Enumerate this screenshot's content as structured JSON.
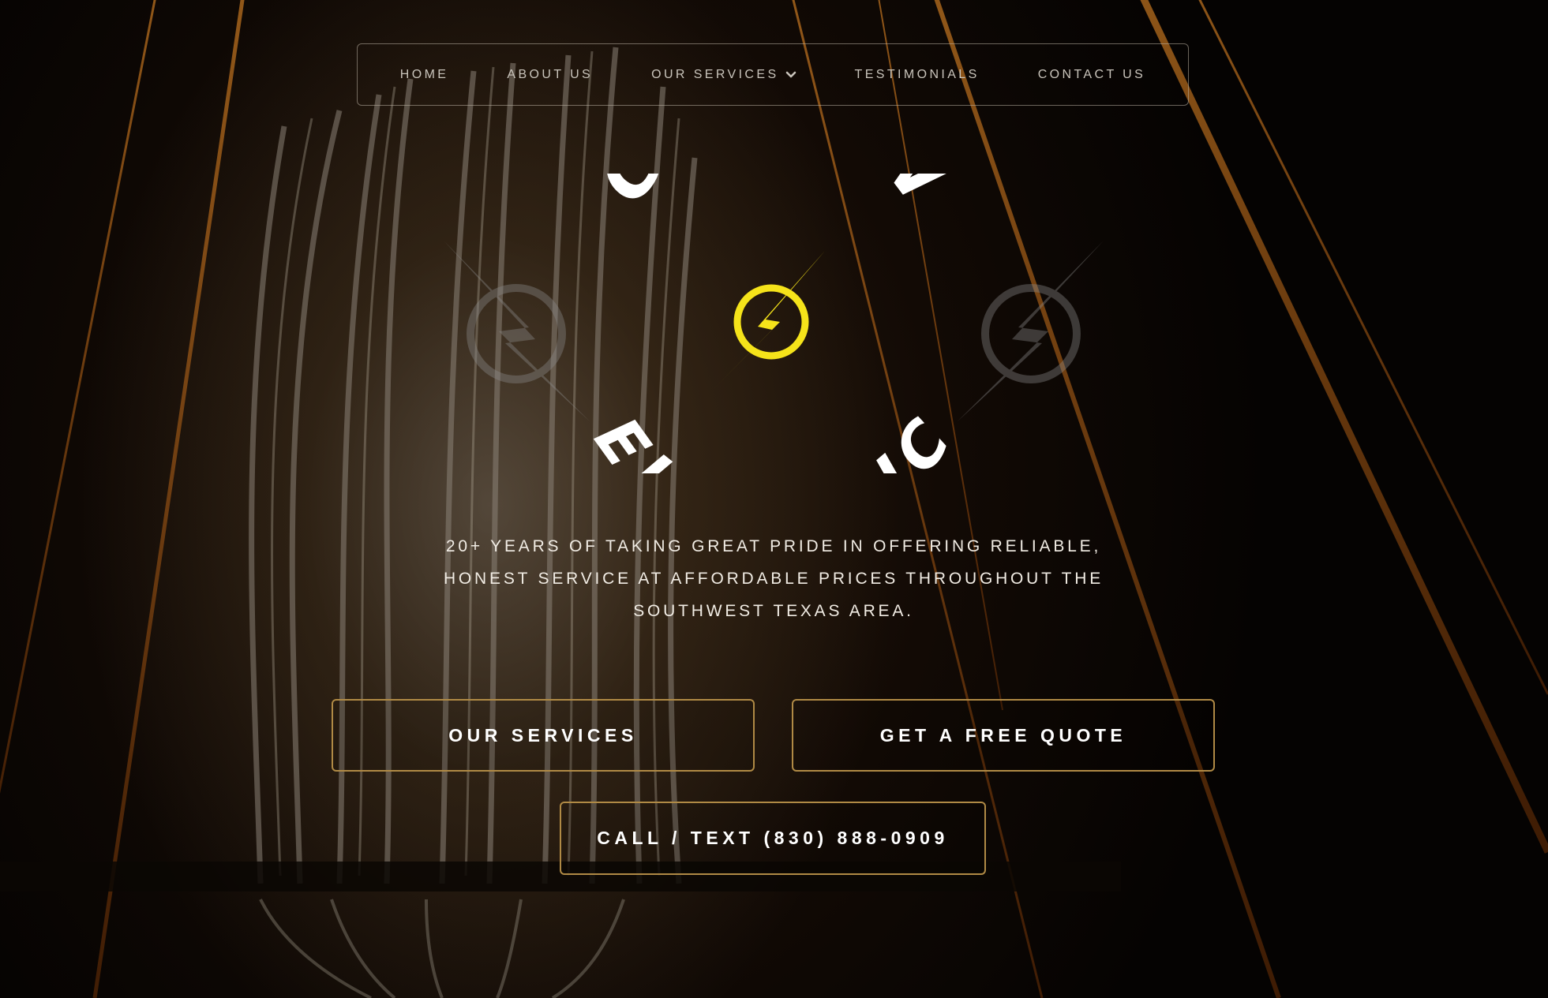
{
  "nav": {
    "items": [
      {
        "label": "HOME"
      },
      {
        "label": "ABOUT US"
      },
      {
        "label": "OUR SERVICES",
        "has_dropdown": true
      },
      {
        "label": "TESTIMONIALS"
      },
      {
        "label": "CONTACT US"
      }
    ]
  },
  "logo": {
    "top_word": "GALVAN",
    "bottom_word": "ELECTRIC",
    "icon": "lightning-bolt-icon",
    "accent_color": "#f5e31a"
  },
  "hero": {
    "tagline_lines": [
      "20+ YEARS OF TAKING GREAT PRIDE IN OFFERING RELIABLE,",
      "HONEST SERVICE AT AFFORDABLE PRICES THROUGHOUT THE",
      "SOUTHWEST TEXAS AREA."
    ]
  },
  "buttons": {
    "services": "OUR SERVICES",
    "quote": "GET A FREE QUOTE",
    "call": "CALL / TEXT (830) 888-0909"
  },
  "colors": {
    "button_border": "#b08a45",
    "nav_text": "#c9c4bb",
    "text": "#ffffff"
  }
}
